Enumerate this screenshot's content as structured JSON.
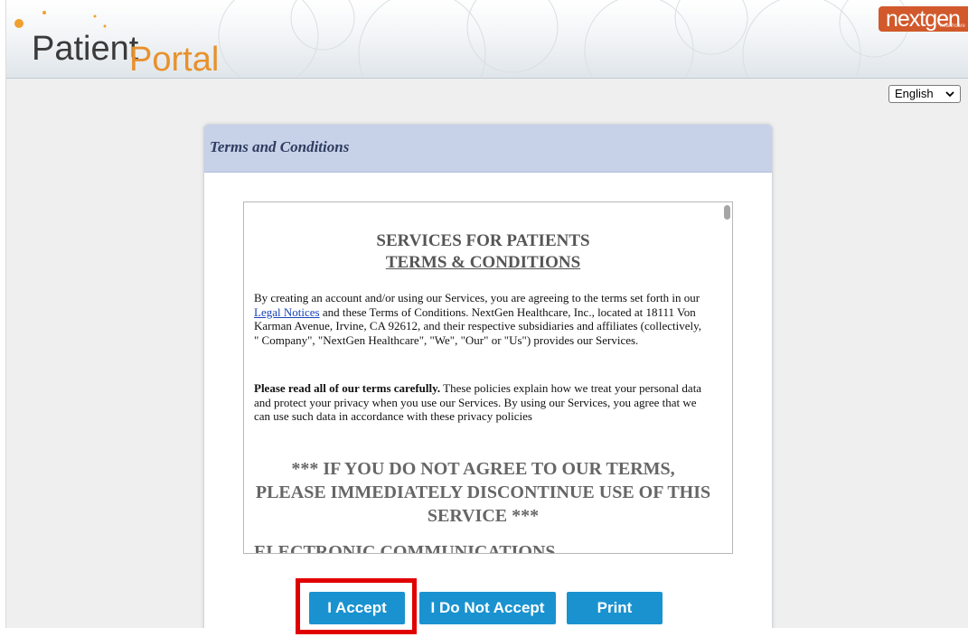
{
  "header": {
    "logo_patient": "Patient",
    "logo_portal": "Portal",
    "brand": "nextgen",
    "brand_sub": "healthcare"
  },
  "language": {
    "selected": "English"
  },
  "card": {
    "title": "Terms and Conditions"
  },
  "terms": {
    "heading": "SERVICES FOR PATIENTS",
    "subheading": "TERMS & CONDITIONS",
    "para1_before": "By creating an account and/or using our Services, you are agreeing to the terms set forth in our ",
    "para1_link": "Legal Notices",
    "para1_after": " and these Terms of Conditions. NextGen Healthcare, Inc., located at 18111 Von Karman Avenue, Irvine, CA 92612, and their respective subsidiaries and affiliates (collectively, \" Company\", \"NextGen Healthcare\", \"We\", \"Our\" or \"Us\") provides our Services.",
    "para2_bold": "Please read all of our terms carefully.",
    "para2_rest": " These policies explain how we treat your personal data and protect your privacy when you use our Services. By using our Services, you agree that we can use such data in accordance with these privacy policies",
    "warning": "*** IF YOU DO NOT AGREE TO OUR TERMS, PLEASE IMMEDIATELY DISCONTINUE USE OF THIS SERVICE ***",
    "next_section": "ELECTRONIC COMMUNICATIONS"
  },
  "buttons": {
    "accept": "I Accept",
    "decline": "I Do Not Accept",
    "print": "Print"
  },
  "colors": {
    "button_blue": "#1a92d0",
    "highlight_red": "#e10000",
    "card_header": "#c7d1e8",
    "portal_orange": "#e8912c"
  }
}
